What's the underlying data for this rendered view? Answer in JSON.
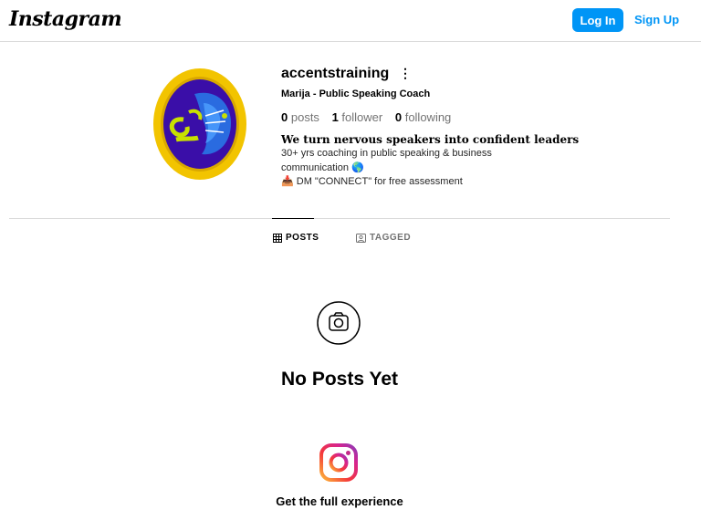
{
  "header": {
    "logo_text": "Instagram",
    "login_label": "Log In",
    "signup_label": "Sign Up"
  },
  "profile": {
    "username": "accentstraining",
    "more_label": "⋮",
    "full_name": "Marija - Public Speaking Coach",
    "stats": {
      "posts_count": "0",
      "posts_label": "posts",
      "followers_count": "1",
      "followers_label": "follower",
      "following_count": "0",
      "following_label": "following"
    },
    "bio": {
      "headline": "We turn nervous speakers into confident leaders",
      "line1": "30+ yrs coaching in public speaking & business",
      "line2": "communication 🌎",
      "line3": "📥 DM \"CONNECT\" for free assessment"
    }
  },
  "tabs": [
    {
      "label": "POSTS",
      "active": true,
      "icon": "grid-icon"
    },
    {
      "label": "TAGGED",
      "active": false,
      "icon": "tag-icon"
    }
  ],
  "empty_state": {
    "icon": "camera-icon",
    "title": "No Posts Yet"
  },
  "promo": {
    "icon": "instagram-icon",
    "title": "Get the full experience"
  },
  "colors": {
    "accent": "#0095f6",
    "avatar_ring": "#f2c400",
    "avatar_inner": "#3a0ea8"
  }
}
